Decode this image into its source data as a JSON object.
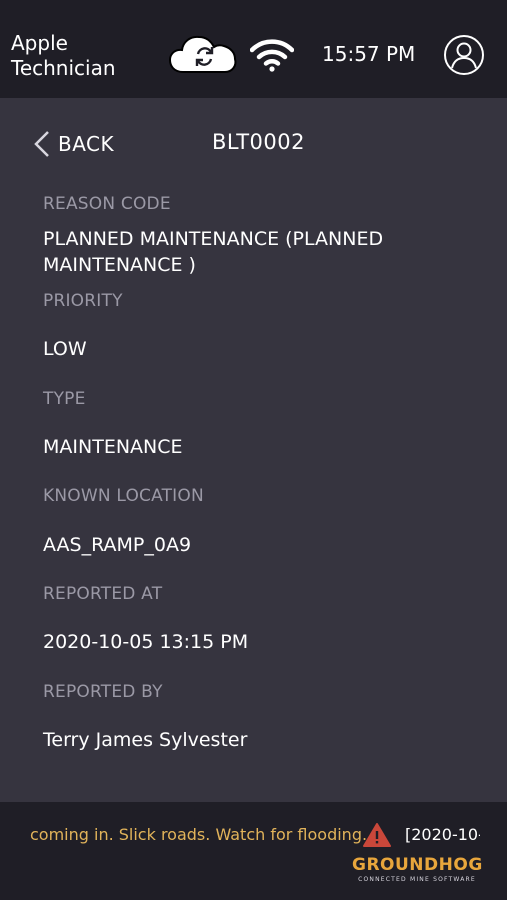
{
  "header": {
    "user_first": "Apple",
    "user_last": "Technician",
    "time": "15:57 PM"
  },
  "nav": {
    "back_label": "BACK",
    "title": "BLT0002"
  },
  "fields": [
    {
      "label": "REASON CODE",
      "value": "PLANNED MAINTENANCE (PLANNED MAINTENANCE )"
    },
    {
      "label": "PRIORITY",
      "value": "LOW"
    },
    {
      "label": "TYPE",
      "value": "MAINTENANCE"
    },
    {
      "label": "KNOWN LOCATION",
      "value": "AAS_RAMP_0A9"
    },
    {
      "label": "REPORTED AT",
      "value": "2020-10-05 13:15 PM"
    },
    {
      "label": "REPORTED BY",
      "value": "Terry James Sylvester"
    }
  ],
  "footer": {
    "ticker_text": "coming in. Slick roads. Watch for flooding.",
    "ticker_date": "[2020-10-",
    "brand_name": "GROUNDHOG",
    "brand_tagline": "CONNECTED MINE SOFTWARE"
  },
  "colors": {
    "topbar_bg": "#1f1e26",
    "content_bg": "#36343f",
    "label_gray": "#9b99a6",
    "ticker_yellow": "#e1b35a",
    "alert_red": "#c9473a",
    "brand_orange": "#e8a63c"
  },
  "icons": [
    "cloud-sync-icon",
    "wifi-icon",
    "profile-icon",
    "chevron-left-icon",
    "warning-icon"
  ]
}
